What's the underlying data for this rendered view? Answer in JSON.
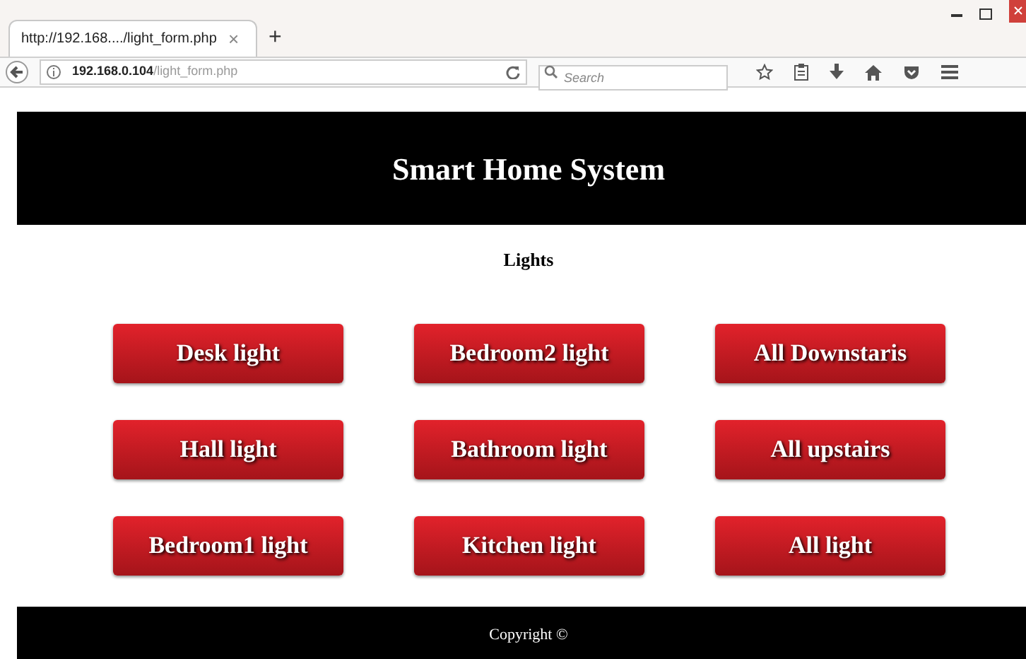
{
  "tab": {
    "title": "http://192.168..../light_form.php",
    "close": "×",
    "new_tab": "+"
  },
  "address_bar": {
    "host": "192.168.0.104",
    "path": "/light_form.php"
  },
  "search": {
    "placeholder": "Search"
  },
  "page": {
    "title": "Smart Home System",
    "heading": "Lights",
    "buttons": [
      "Desk light",
      "Bedroom2 light",
      "All Downstaris",
      "Hall light",
      "Bathroom light",
      "All upstairs",
      "Bedroom1 light",
      "Kitchen light",
      "All light"
    ],
    "footer": "Copyright ©"
  }
}
